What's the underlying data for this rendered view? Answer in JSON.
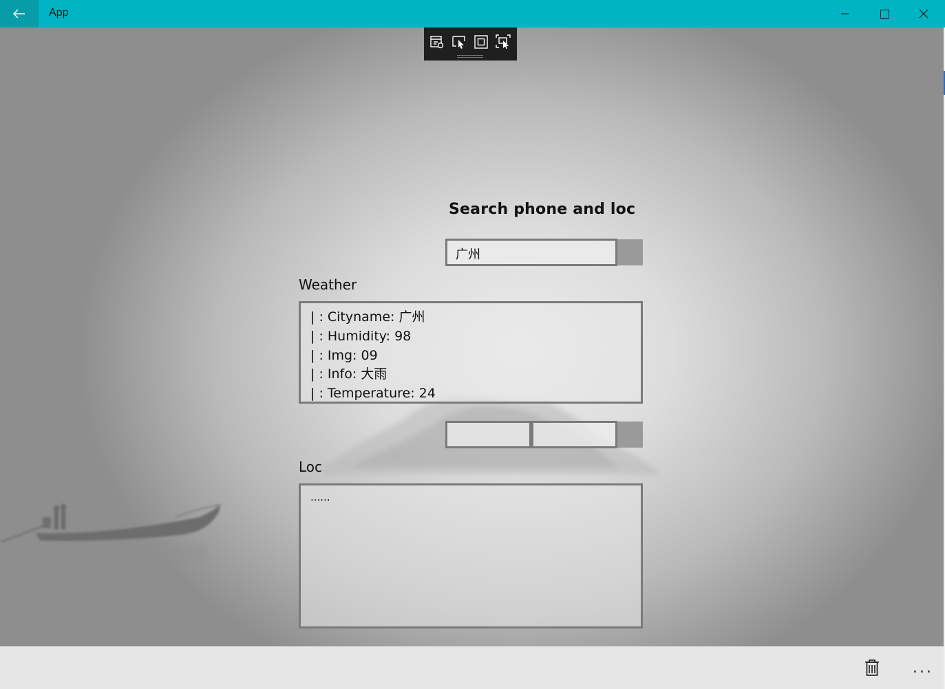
{
  "window": {
    "title": "App",
    "accent_color": "#00b4c4",
    "back_icon": "arrow-left-icon",
    "minimize_icon": "minimize-icon",
    "maximize_icon": "maximize-icon",
    "close_icon": "close-icon"
  },
  "debug_toolbar": {
    "icons": [
      "live-visual-tree-icon",
      "select-element-icon",
      "display-layout-adorners-icon",
      "track-focus-icon"
    ]
  },
  "main": {
    "heading": "Search phone and loc",
    "search": {
      "value": "广州"
    },
    "weather": {
      "label": "Weather",
      "lines": [
        "| : Cityname: 广州",
        "| : Humidity: 98",
        "| : Img: 09",
        "| : Info: 大雨",
        "| : Temperature: 24"
      ]
    },
    "phone_inputs": {
      "first_value": "",
      "second_value": ""
    },
    "loc": {
      "label": "Loc",
      "text": "......"
    }
  },
  "command_bar": {
    "icons": [
      "trash-icon",
      "more-icon"
    ],
    "more_text": "..."
  }
}
